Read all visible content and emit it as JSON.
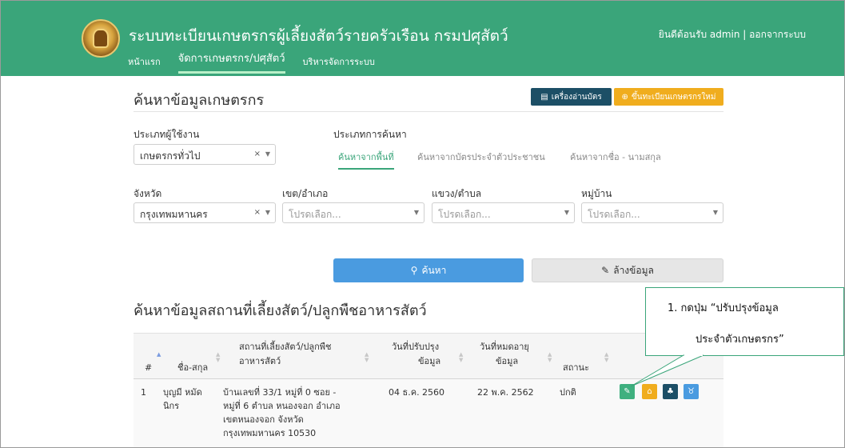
{
  "header": {
    "title": "ระบบทะเบียนเกษตรกรผู้เลี้ยงสัตว์รายครัวเรือน กรมปศุสัตว์",
    "nav": [
      "หน้าแรก",
      "จัดการเกษตรกร/ปศุสัตว์",
      "บริหารจัดการระบบ"
    ],
    "welcome": "ยินดีต้อนรับ admin | ออกจากระบบ"
  },
  "page": {
    "title": "ค้นหาข้อมูลเกษตรกร",
    "card_reader_label": "เครื่องอ่านบัตร",
    "register_label": "ขึ้นทะเบียนเกษตรกรใหม่"
  },
  "form": {
    "user_type_label": "ประเภทผู้ใช้งาน",
    "user_type_value": "เกษตรกรทั่วไป",
    "search_type_label": "ประเภทการค้นหา",
    "search_tabs": [
      "ค้นหาจากพื้นที่",
      "ค้นหาจากบัตรประจำตัวประชาชน",
      "ค้นหาจากชื่อ - นามสกุล"
    ],
    "province_label": "จังหวัด",
    "province_value": "กรุงเทพมหานคร",
    "district_label": "เขต/อำเภอ",
    "subdistrict_label": "แขวง/ตำบล",
    "village_label": "หมู่บ้าน",
    "placeholder": "โปรดเลือก...",
    "clear_x": "×",
    "caret": "▼",
    "search_button": "ค้นหา",
    "clear_button": "ล้างข้อมูล"
  },
  "results": {
    "title": "ค้นหาข้อมูลสถานที่เลี้ยงสัตว์/ปลูกพืชอาหารสัตว์",
    "columns": {
      "num": "#",
      "name": "ชื่อ-สกุล",
      "place_1": "สถานที่เลี้ยงสัตว์/ปลูกพืช",
      "place_2": "อาหารสัตว์",
      "updated_1": "วันที่ปรับปรุง",
      "updated_2": "ข้อมูล",
      "expiry_1": "วันที่หมดอายุ",
      "expiry_2": "ข้อมูล",
      "status": "สถานะ"
    },
    "rows": [
      {
        "num": "1",
        "name_1": "บุญมี หมัด",
        "name_2": "นิกร",
        "place_1": "บ้านเลขที่ 33/1 หมู่ที่ 0 ซอย -",
        "place_2": "หมู่ที่ 6 ตำบล หนองจอก อำเภอ",
        "place_3": "เขตหนองจอก จังหวัด",
        "place_4": "กรุงเทพมหานคร 10530",
        "updated": "04 ธ.ค. 2560",
        "expiry": "22 พ.ค. 2562",
        "status": "ปกติ"
      }
    ]
  },
  "callout": {
    "line1": "1. กดปุ่ม “ปรับปรุงข้อมูล",
    "line2": "ประจำตัวเกษตรกร”"
  },
  "icons": {
    "card_reader": "id-card-icon",
    "register": "user-plus-icon",
    "search": "search-icon",
    "eraser": "eraser-icon",
    "actions": [
      "edit-farmer-icon",
      "house-icon",
      "tree-icon",
      "livestock-icon"
    ]
  },
  "colors": {
    "header_green": "#3aa57a",
    "navy": "#1c4f66",
    "orange": "#f0ad1e",
    "blue": "#4a9be0",
    "action_green": "#3fb07f",
    "action_orange": "#f0ad1e",
    "action_navy": "#1c4f66",
    "action_blue": "#4a9be0"
  }
}
